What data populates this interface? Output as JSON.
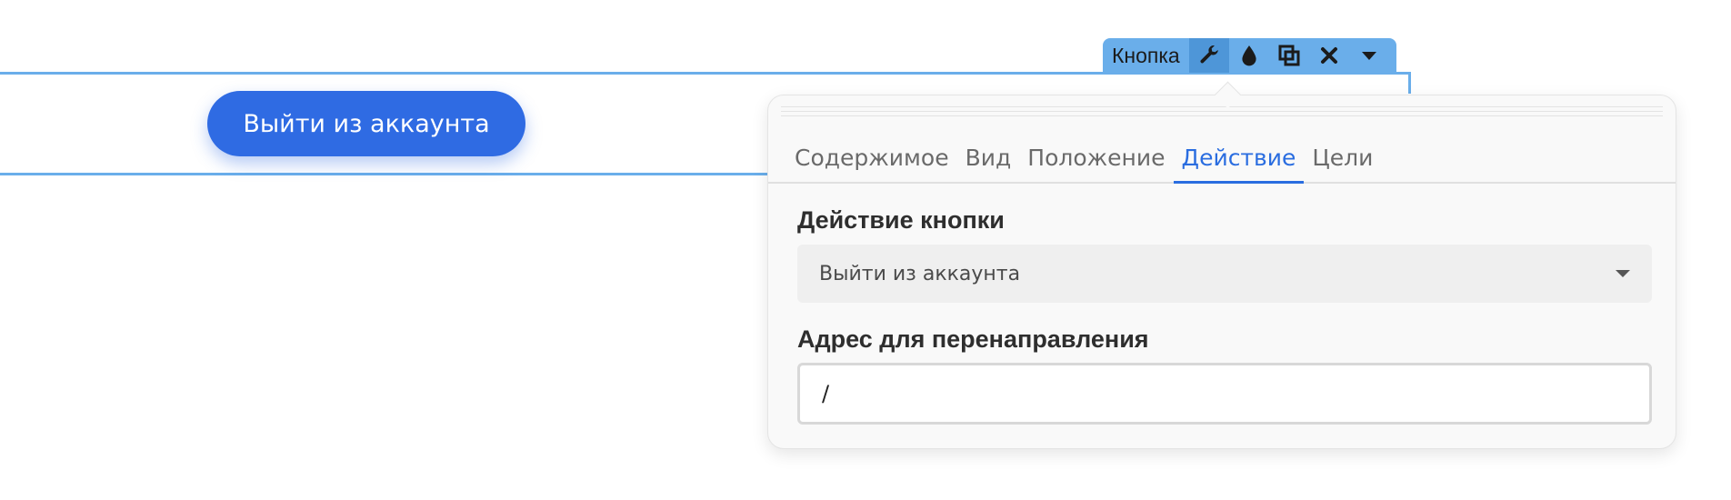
{
  "canvas": {
    "button_label": "Выйти из аккаунта"
  },
  "toolbar": {
    "label": "Кнопка",
    "icons": [
      "wrench-icon",
      "drop-icon",
      "duplicate-icon",
      "close-icon",
      "caret-down-icon"
    ],
    "color": "#6aaeea"
  },
  "panel": {
    "tabs": [
      {
        "label": "Содержимое"
      },
      {
        "label": "Вид"
      },
      {
        "label": "Положение"
      },
      {
        "label": "Действие",
        "active": true
      },
      {
        "label": "Цели"
      }
    ],
    "action_label": "Действие кнопки",
    "action_value": "Выйти из аккаунта",
    "redirect_label": "Адрес для перенаправления",
    "redirect_value": "/"
  },
  "colors": {
    "accent": "#2a6de0",
    "button": "#2f6be3",
    "outline": "#6aaeea"
  }
}
